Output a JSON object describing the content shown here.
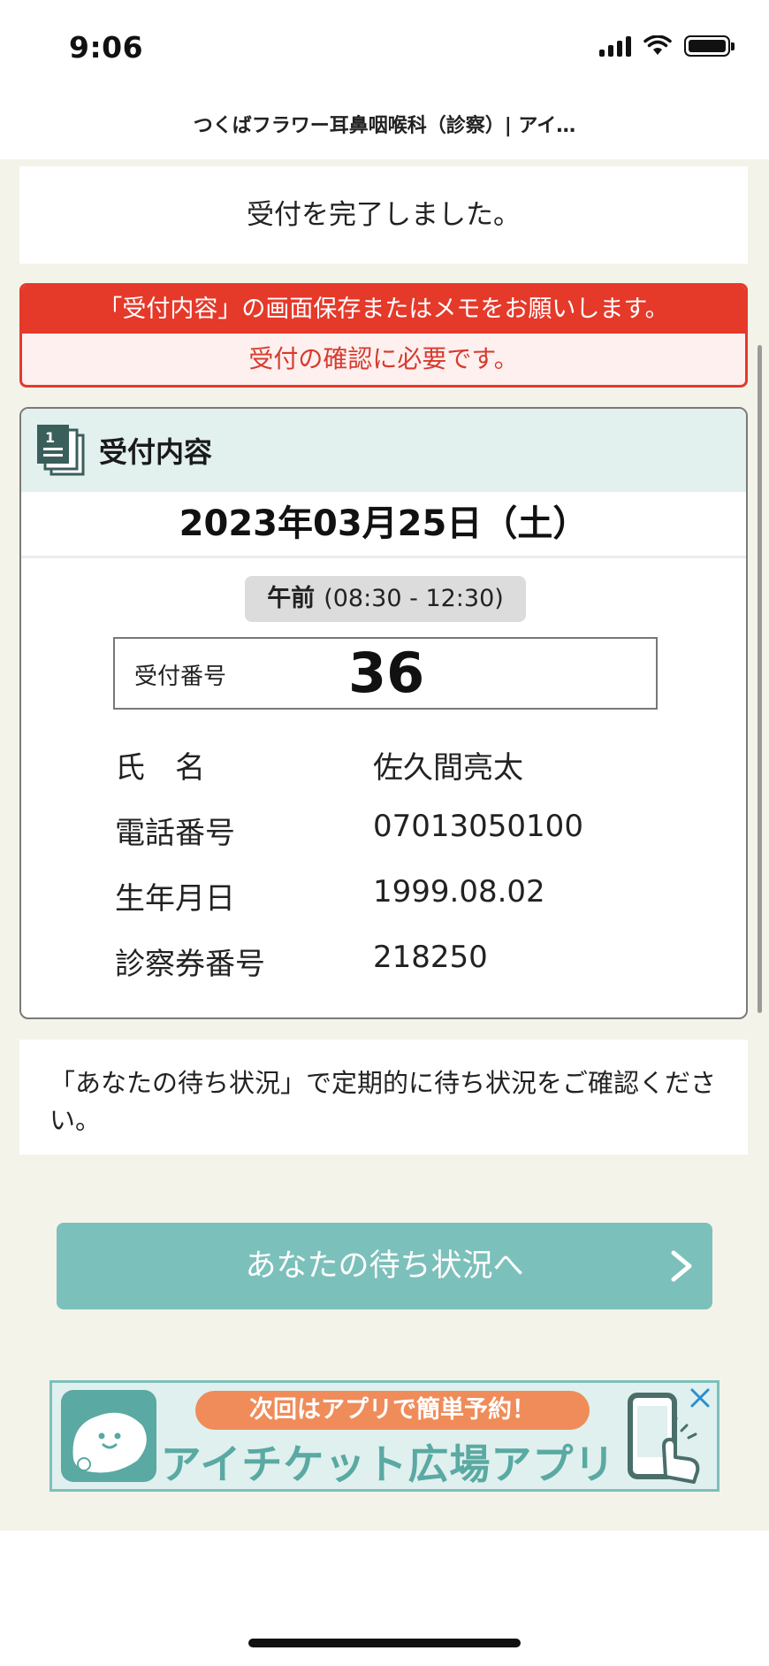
{
  "status_bar": {
    "time": "9:06"
  },
  "page": {
    "title": "つくばフラワー耳鼻咽喉科（診察）| アイ…"
  },
  "completion": {
    "message": "受付を完了しました。"
  },
  "notice": {
    "line1": "「受付内容」の画面保存またはメモをお願いします。",
    "line2": "受付の確認に必要です。",
    "color": "#e5392a"
  },
  "reception": {
    "heading": "受付内容",
    "icon": "document-stack-icon",
    "date": "2023年03月25日（土）",
    "period_label": "午前",
    "period_time": "(08:30 - 12:30)",
    "number_label": "受付番号",
    "number": "36",
    "fields": [
      {
        "label": "氏　名",
        "value": "佐久間亮太"
      },
      {
        "label": "電話番号",
        "value": "07013050100"
      },
      {
        "label": "生年月日",
        "value": "1999.08.02"
      },
      {
        "label": "診察券番号",
        "value": "218250"
      }
    ]
  },
  "wait_note": {
    "text": "「あなたの待ち状況」で定期的に待ち状況をご確認ください。"
  },
  "wait_button": {
    "label": "あなたの待ち状況へ",
    "icon": "chevron-right-icon",
    "color": "#7cc0bb"
  },
  "banner": {
    "tagline": "次回はアプリで簡単予約！",
    "title": "アイチケット広場アプリ",
    "close_icon": "close-icon"
  }
}
